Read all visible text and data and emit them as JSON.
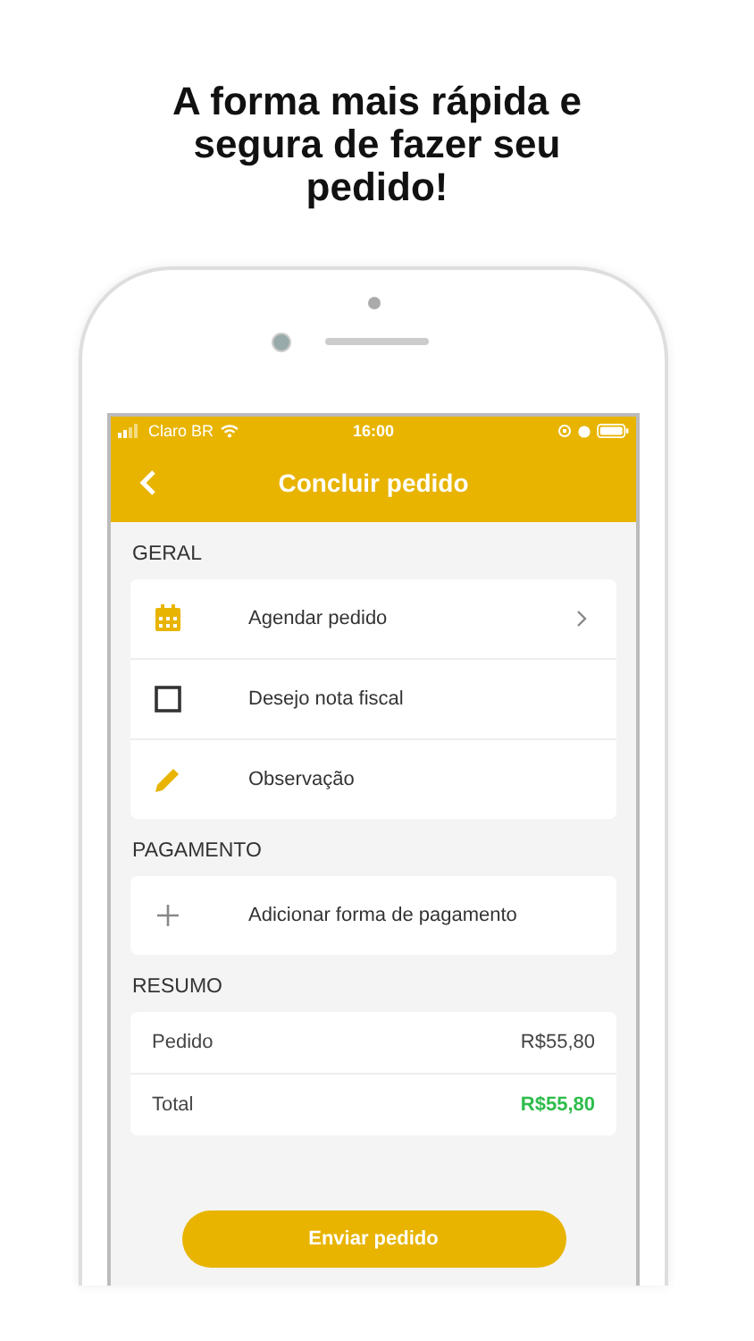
{
  "headline": "A forma mais rápida e segura de fazer seu pedido!",
  "status_bar": {
    "carrier": "Claro BR",
    "time": "16:00"
  },
  "nav": {
    "back": true,
    "title": "Concluir pedido"
  },
  "sections": [
    {
      "title": "GERAL",
      "items": [
        {
          "kind": "link",
          "label": "Agendar pedido"
        },
        {
          "kind": "checkbox",
          "label": "Desejo nota fiscal",
          "checked": false
        },
        {
          "kind": "note",
          "label": "Observação"
        }
      ]
    },
    {
      "title": "PAGAMENTO",
      "items": [
        {
          "kind": "add",
          "label": "Adicionar forma de pagamento"
        }
      ]
    }
  ],
  "summary": {
    "title": "RESUMO",
    "rows": [
      {
        "kind": "line",
        "label": "Pedido",
        "value": "R$55,80"
      },
      {
        "kind": "total",
        "label": "Total",
        "value": "R$55,80"
      }
    ]
  },
  "submit": "Enviar pedido"
}
